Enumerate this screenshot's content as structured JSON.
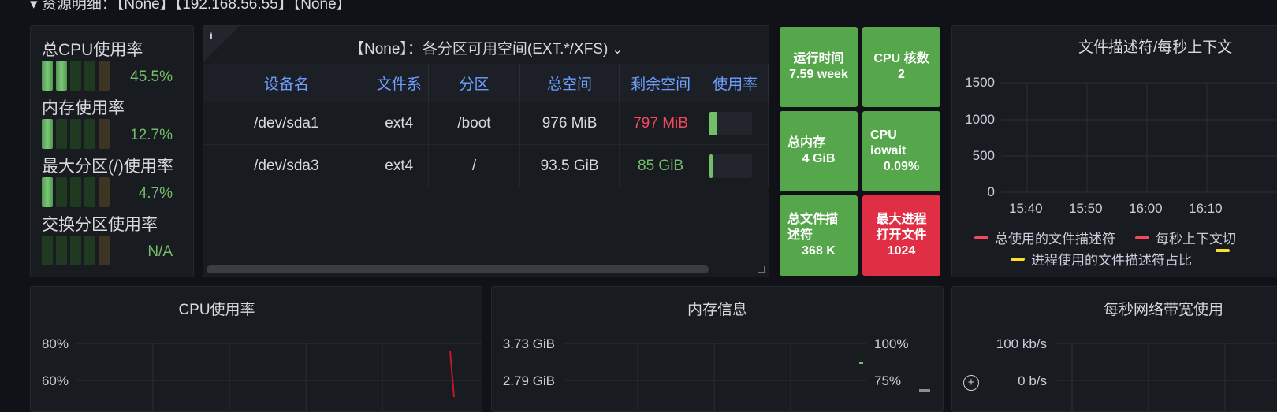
{
  "row_title": "▾ 资源明细：【None】【192.168.56.55】【None】",
  "gauges": [
    {
      "label": "总CPU使用率",
      "value": "45.5%",
      "level": 0.455
    },
    {
      "label": "内存使用率",
      "value": "12.7%",
      "level": 0.127
    },
    {
      "label": "最大分区(/)使用率",
      "value": "4.7%",
      "level": 0.047
    },
    {
      "label": "交换分区使用率",
      "value": "N/A",
      "level": 0
    }
  ],
  "fs_panel": {
    "info_icon": "info-icon",
    "title": "【None】：各分区可用空间(EXT.*/XFS)",
    "chevron": "⌄",
    "columns": [
      "设备名",
      "文件系",
      "分区",
      "总空间",
      "剩余空间",
      "使用率"
    ],
    "rows": [
      {
        "device": "/dev/sda1",
        "fs": "ext4",
        "mount": "/boot",
        "total": "976 MiB",
        "free": "797 MiB",
        "free_color": "#f2495c",
        "usage": 0.18
      },
      {
        "device": "/dev/sda3",
        "fs": "ext4",
        "mount": "/",
        "total": "93.5 GiB",
        "free": "85 GiB",
        "free_color": "#73bf69",
        "usage": 0.05
      }
    ]
  },
  "tiles": [
    {
      "title": "运行时间",
      "value": "7.59 week",
      "color": "#56a64b"
    },
    {
      "title": "CPU 核数",
      "value": "2",
      "color": "#56a64b"
    },
    {
      "title": "总内存",
      "value": "4 GiB",
      "color": "#56a64b"
    },
    {
      "title": "CPU iowait",
      "value": "0.09%",
      "color": "#56a64b"
    },
    {
      "title": "总文件描述符",
      "value": "368 K",
      "color": "#56a64b"
    },
    {
      "title": "最大进程打开文件",
      "value": "1024",
      "color": "#e02f44"
    }
  ],
  "fd_chart": {
    "title": "文件描述符/每秒上下文",
    "yticks": [
      "1500",
      "1000",
      "500",
      "0"
    ],
    "xticks": [
      "15:40",
      "15:50",
      "16:00",
      "16:10"
    ],
    "legend": [
      {
        "name": "总使用的文件描述符",
        "color": "#f2495c"
      },
      {
        "name": "每秒上下文切",
        "color": "#f2495c"
      },
      {
        "name": "进程使用的文件描述符占比",
        "color": "#fade2a"
      },
      {
        "name": "",
        "color": "#fade2a"
      }
    ]
  },
  "cpu_chart": {
    "title": "CPU使用率",
    "yticks": [
      "80%",
      "60%"
    ]
  },
  "mem_chart": {
    "title": "内存信息",
    "yticks_left": [
      "3.73 GiB",
      "2.79 GiB"
    ],
    "yticks_right": [
      "100%",
      "75%"
    ]
  },
  "net_chart": {
    "title": "每秒网络带宽使用",
    "yticks": [
      "100 kb/s",
      "0 b/s"
    ],
    "zoom_icon": "zoom-in-icon"
  }
}
